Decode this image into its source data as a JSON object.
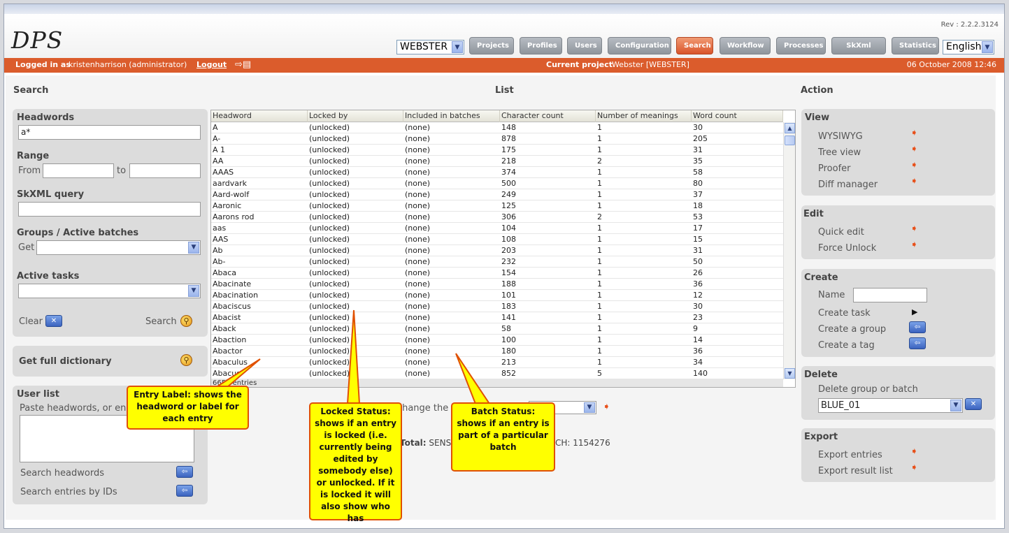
{
  "app": {
    "logo": "DPS",
    "version": "Rev : 2.2.2.3124",
    "project_select": "WEBSTER",
    "language_select": "English",
    "nav": [
      {
        "label": "Projects",
        "active": false
      },
      {
        "label": "Profiles",
        "active": false
      },
      {
        "label": "Users",
        "active": false
      },
      {
        "label": "Configuration",
        "active": false
      },
      {
        "label": "Search",
        "active": true
      },
      {
        "label": "Workflow",
        "active": false
      },
      {
        "label": "Processes",
        "active": false
      },
      {
        "label": "SkXml Box",
        "active": false
      },
      {
        "label": "Statistics",
        "active": false
      }
    ]
  },
  "status_bar": {
    "logged_in_label": "Logged in as",
    "user": "kristenharrison (administrator)",
    "logout": "Logout",
    "current_project_label": "Current project",
    "current_project": "Webster [WEBSTER]",
    "datetime": "06 October 2008 12:46"
  },
  "search": {
    "title": "Search",
    "headwords_label": "Headwords",
    "headwords_value": "a*",
    "range_label": "Range",
    "from_label": "From",
    "to_label": "to",
    "skxml_label": "SkXML query",
    "groups_label": "Groups / Active batches",
    "get_label": "Get",
    "active_tasks_label": "Active tasks",
    "clear_label": "Clear",
    "search_label": "Search",
    "full_dict_label": "Get full dictionary",
    "user_list_label": "User list",
    "paste_label": "Paste headwords, or en",
    "search_headwords": "Search headwords",
    "search_ids": "Search entries by IDs"
  },
  "list": {
    "title": "List",
    "columns": [
      "Headword",
      "Locked by",
      "Included in batches",
      "Character count",
      "Number of meanings",
      "Word count"
    ],
    "rows": [
      [
        "A",
        "(unlocked)",
        "(none)",
        "148",
        "1",
        "30"
      ],
      [
        "A-",
        "(unlocked)",
        "(none)",
        "878",
        "1",
        "205"
      ],
      [
        "A 1",
        "(unlocked)",
        "(none)",
        "175",
        "1",
        "31"
      ],
      [
        "AA",
        "(unlocked)",
        "(none)",
        "218",
        "2",
        "35"
      ],
      [
        "AAAS",
        "(unlocked)",
        "(none)",
        "374",
        "1",
        "58"
      ],
      [
        "aardvark",
        "(unlocked)",
        "(none)",
        "500",
        "1",
        "80"
      ],
      [
        "Aard-wolf",
        "(unlocked)",
        "(none)",
        "249",
        "1",
        "37"
      ],
      [
        "Aaronic",
        "(unlocked)",
        "(none)",
        "125",
        "1",
        "18"
      ],
      [
        "Aarons rod",
        "(unlocked)",
        "(none)",
        "306",
        "2",
        "53"
      ],
      [
        "aas",
        "(unlocked)",
        "(none)",
        "104",
        "1",
        "17"
      ],
      [
        "AAS",
        "(unlocked)",
        "(none)",
        "108",
        "1",
        "15"
      ],
      [
        "Ab",
        "(unlocked)",
        "(none)",
        "203",
        "1",
        "31"
      ],
      [
        "Ab-",
        "(unlocked)",
        "(none)",
        "232",
        "1",
        "50"
      ],
      [
        "Abaca",
        "(unlocked)",
        "(none)",
        "154",
        "1",
        "26"
      ],
      [
        "Abacinate",
        "(unlocked)",
        "(none)",
        "188",
        "1",
        "36"
      ],
      [
        "Abacination",
        "(unlocked)",
        "(none)",
        "101",
        "1",
        "12"
      ],
      [
        "Abaciscus",
        "(unlocked)",
        "(none)",
        "183",
        "1",
        "30"
      ],
      [
        "Abacist",
        "(unlocked)",
        "(none)",
        "141",
        "1",
        "23"
      ],
      [
        "Aback",
        "(unlocked)",
        "(none)",
        "58",
        "1",
        "9"
      ],
      [
        "Abaction",
        "(unlocked)",
        "(none)",
        "100",
        "1",
        "14"
      ],
      [
        "Abactor",
        "(unlocked)",
        "(none)",
        "180",
        "1",
        "36"
      ],
      [
        "Abaculus",
        "(unlocked)",
        "(none)",
        "213",
        "1",
        "34"
      ],
      [
        "Abacus",
        "(unlocked)",
        "(none)",
        "852",
        "5",
        "140"
      ]
    ],
    "footer": "6650 entries",
    "change_label": "Change the s",
    "total_label": "Total:",
    "total_text": "SENS",
    "total_tail": "CH: 1154276"
  },
  "action": {
    "title": "Action",
    "view_label": "View",
    "view_items": [
      "WYSIWYG",
      "Tree view",
      "Proofer",
      "Diff manager"
    ],
    "edit_label": "Edit",
    "edit_items": [
      "Quick edit",
      "Force Unlock"
    ],
    "create_label": "Create",
    "name_label": "Name",
    "create_items": [
      "Create task",
      "Create a group",
      "Create a tag"
    ],
    "delete_label": "Delete",
    "delete_text": "Delete group or batch",
    "delete_select": "BLUE_01",
    "export_label": "Export",
    "export_items": [
      "Export entries",
      "Export result list"
    ]
  },
  "callouts": {
    "entry_label": "Entry Label: shows the headword or label for each entry",
    "locked_status": "Locked Status: shows if an entry is locked (i.e. currently being edited by somebody else) or unlocked. If it is locked it will also show who has",
    "batch_status": "Batch Status: shows if an entry is part of a particular batch"
  },
  "colors": {
    "accent": "#db5c2c",
    "callout_fill": "#ffff00",
    "callout_border": "#e05000",
    "panel": "#dcdcdc"
  }
}
